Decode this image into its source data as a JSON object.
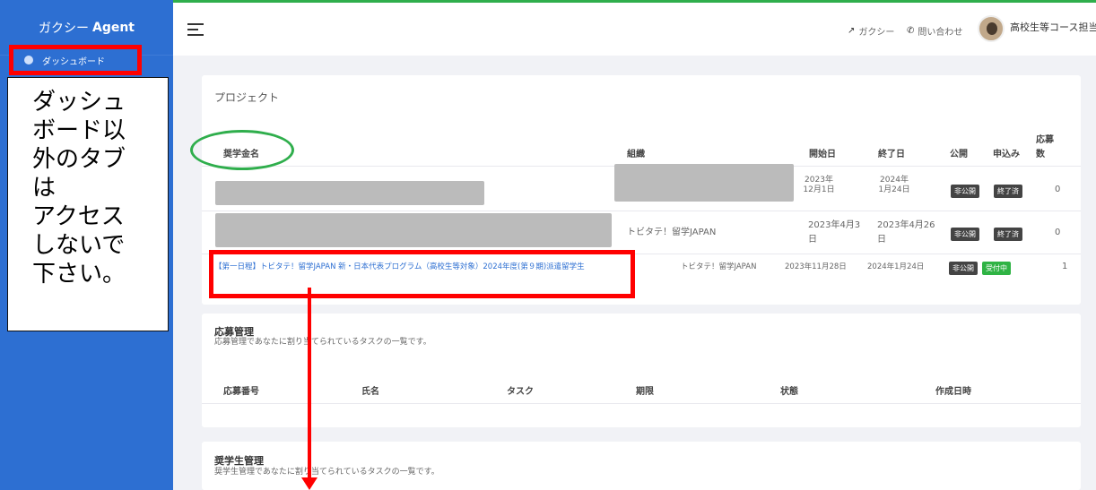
{
  "app": {
    "brand_light": "ガクシー",
    "brand_bold": "Agent"
  },
  "sidebar": {
    "items": [
      {
        "label": "ダッシュボード",
        "icon": "dashboard-icon"
      }
    ]
  },
  "note": {
    "text": "ダッシュ\nボード以\n外のタブ\nは\nアクセス\nしないで\n下さい。"
  },
  "topbar": {
    "links": [
      {
        "label": "ガクシー",
        "icon": "external-link-icon"
      },
      {
        "label": "問い合わせ",
        "icon": "phone-icon"
      }
    ],
    "user_name": "高校生等コース担当"
  },
  "project": {
    "title": "プロジェクト",
    "headers": {
      "name": "奨学金名",
      "org": "組織",
      "start": "開始日",
      "end": "終了日",
      "public": "公開",
      "apply": "申込み",
      "count_1": "応募",
      "count_2": "数"
    },
    "rows": [
      {
        "name": "",
        "org": "",
        "start_1": "2023年",
        "start_2": "12月1日",
        "end_1": "2024年",
        "end_2": "1月24日",
        "public": "非公開",
        "apply": "終了済",
        "count": "0"
      },
      {
        "name": "",
        "org": "トビタテ！留学JAPAN",
        "start_1": "2023年4月3",
        "start_2": "日",
        "end_1": "2023年4月26",
        "end_2": "日",
        "public": "非公開",
        "apply": "終了済",
        "count": "0"
      },
      {
        "name": "【第一日程】トビタテ！留学JAPAN 新・日本代表プログラム（高校生等対象）2024年度(第９期)派遣留学生",
        "org": "トビタテ！留学JAPAN",
        "start": "2023年11月28日",
        "end": "2024年1月24日",
        "public": "非公開",
        "apply": "受付中",
        "count": "1"
      }
    ]
  },
  "applications": {
    "title": "応募管理",
    "subtitle": "応募管理であなたに割り当てられているタスクの一覧です。",
    "headers": {
      "number": "応募番号",
      "name": "氏名",
      "task": "タスク",
      "due": "期限",
      "status": "状態",
      "created": "作成日時"
    }
  },
  "scholars": {
    "title": "奨学生管理",
    "subtitle": "奨学生管理であなたに割り当てられているタスクの一覧です。"
  },
  "colors": {
    "sidebar": "#2d6fd2",
    "annotation_red": "#ff0000",
    "annotation_green": "#2fae4c",
    "badge_dark": "#444444",
    "badge_green": "#2fb344"
  }
}
